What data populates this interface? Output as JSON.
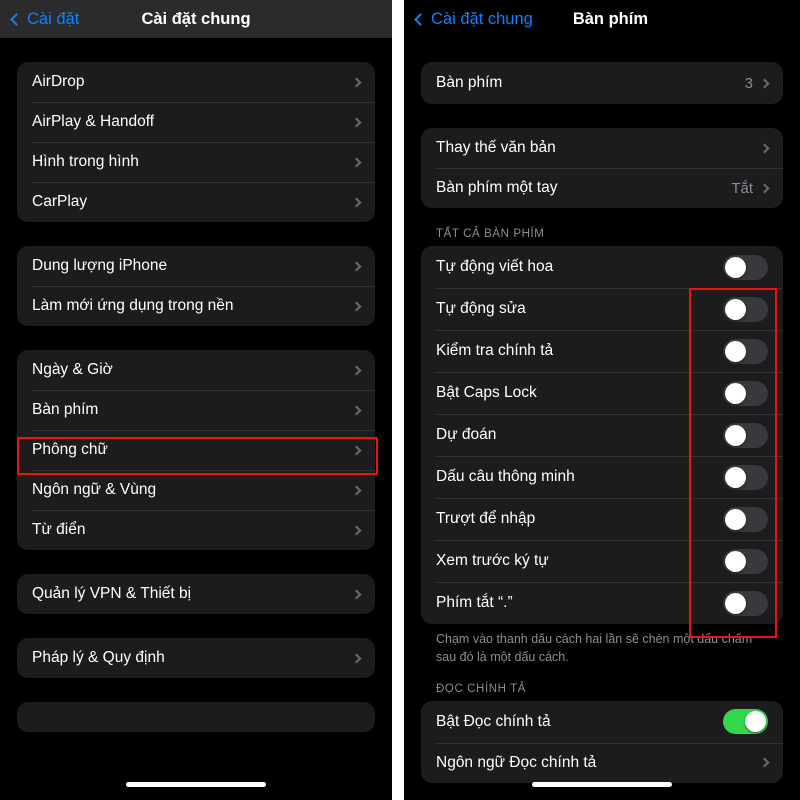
{
  "left_panel": {
    "nav": {
      "back_label": "Cài đặt",
      "back_icon": "chevron-left-icon",
      "title": "Cài đặt chung"
    },
    "groups": [
      {
        "id": "group-connectivity",
        "rows": [
          {
            "label": "AirDrop",
            "accessory": "chevron"
          },
          {
            "label": "AirPlay & Handoff",
            "accessory": "chevron"
          },
          {
            "label": "Hình trong hình",
            "accessory": "chevron"
          },
          {
            "label": "CarPlay",
            "accessory": "chevron"
          }
        ]
      },
      {
        "id": "group-storage",
        "rows": [
          {
            "label": "Dung lượng iPhone",
            "accessory": "chevron"
          },
          {
            "label": "Làm mới ứng dụng trong nền",
            "accessory": "chevron"
          }
        ]
      },
      {
        "id": "group-input",
        "rows": [
          {
            "label": "Ngày & Giờ",
            "accessory": "chevron"
          },
          {
            "label": "Bàn phím",
            "accessory": "chevron",
            "highlighted": true
          },
          {
            "label": "Phông chữ",
            "accessory": "chevron"
          },
          {
            "label": "Ngôn ngữ & Vùng",
            "accessory": "chevron"
          },
          {
            "label": "Từ điển",
            "accessory": "chevron"
          }
        ]
      },
      {
        "id": "group-vpn",
        "rows": [
          {
            "label": "Quản lý VPN & Thiết bị",
            "accessory": "chevron"
          }
        ]
      },
      {
        "id": "group-legal",
        "rows": [
          {
            "label": "Pháp lý & Quy định",
            "accessory": "chevron"
          }
        ]
      }
    ]
  },
  "right_panel": {
    "nav": {
      "back_label": "Cài đặt chung",
      "back_icon": "chevron-left-icon",
      "title": "Bàn phím"
    },
    "group_keyboards": {
      "rows": [
        {
          "label": "Bàn phím",
          "value": "3",
          "accessory": "chevron"
        }
      ]
    },
    "group_text": {
      "rows": [
        {
          "label": "Thay thế văn bản",
          "value": "",
          "accessory": "chevron"
        },
        {
          "label": "Bàn phím một tay",
          "value": "Tắt",
          "accessory": "chevron"
        }
      ]
    },
    "section_all_keyboards": {
      "header": "TẤT CẢ BÀN PHÍM",
      "rows": [
        {
          "label": "Tự động viết hoa",
          "toggle": "off"
        },
        {
          "label": "Tự động sửa",
          "toggle": "off"
        },
        {
          "label": "Kiểm tra chính tả",
          "toggle": "off"
        },
        {
          "label": "Bật Caps Lock",
          "toggle": "off"
        },
        {
          "label": "Dự đoán",
          "toggle": "off"
        },
        {
          "label": "Dấu câu thông minh",
          "toggle": "off"
        },
        {
          "label": "Trượt để nhập",
          "toggle": "off"
        },
        {
          "label": "Xem trước ký tự",
          "toggle": "off"
        },
        {
          "label": "Phím tắt “.”",
          "toggle": "off"
        }
      ],
      "footnote": "Chạm vào thanh dấu cách hai lần sẽ chèn một dấu chấm sau đó là một dấu cách."
    },
    "section_dictation": {
      "header": "ĐỌC CHÍNH TẢ",
      "rows": [
        {
          "label": "Bật Đọc chính tả",
          "toggle": "on"
        },
        {
          "label": "Ngôn ngữ Đọc chính tả",
          "accessory": "chevron"
        }
      ]
    }
  },
  "annotations": {
    "highlight_color": "#ee1111",
    "left_box_target": "Bàn phím",
    "right_box_target": "toggle-column"
  }
}
